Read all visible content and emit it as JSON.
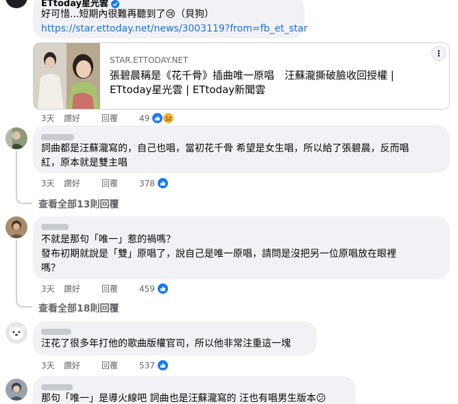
{
  "post_comment": {
    "author": "ETtoday星光雲",
    "text": "好可惜...短期內很難再聽到了😢（貝狗）",
    "link": "https://star.ettoday.net/news/3003119?from=fb_et_star",
    "card": {
      "domain": "STAR.ETTODAY.NET",
      "title_line1": "張碧晨稱是《花千骨》插曲唯一原唱　汪蘇瀧撕破臉收回授權 |",
      "title_line2": "ETtoday星光雲 | ETtoday新聞雲",
      "more_label": "⋮"
    },
    "meta": {
      "time": "3天",
      "like": "讚好",
      "reply": "回覆",
      "count": "49"
    }
  },
  "comments": [
    {
      "line1": "詞曲都是汪蘇瀧寫的，自己也唱，當初花千骨 希望是女生唱，所以給了張碧晨，反而唱",
      "line2": "紅，原本就是雙主唱",
      "meta": {
        "time": "3天",
        "like": "讚好",
        "reply": "回覆",
        "count": "378"
      },
      "view_replies": "查看全部13則回覆"
    },
    {
      "line1": "不就是那句「唯一」惹的禍嗎？",
      "line2": "發布初期就說是「雙」原唱了，說自己是唯一原唱，請問是沒把另一位原唱放在眼裡",
      "line3": "嗎？",
      "meta": {
        "time": "3天",
        "like": "讚好",
        "reply": "回覆",
        "count": "459"
      },
      "view_replies": "查看全部18則回覆"
    },
    {
      "line1": "汪花了很多年打他的歌曲版權官司，所以他非常注重這一塊",
      "meta": {
        "time": "3天",
        "like": "讚好",
        "reply": "回覆",
        "count": "537"
      }
    },
    {
      "line1": "那句「唯一」是導火線吧 詞曲也是汪蘇瀧寫的 汪也有唱男生版本😕"
    }
  ],
  "colors": {
    "bubble": "#f0f2f5",
    "link": "#216fdb",
    "meta": "#65676b",
    "like_reaction": "#1877f2",
    "sad_reaction": "#f7b125",
    "verified": "#1877f2"
  }
}
